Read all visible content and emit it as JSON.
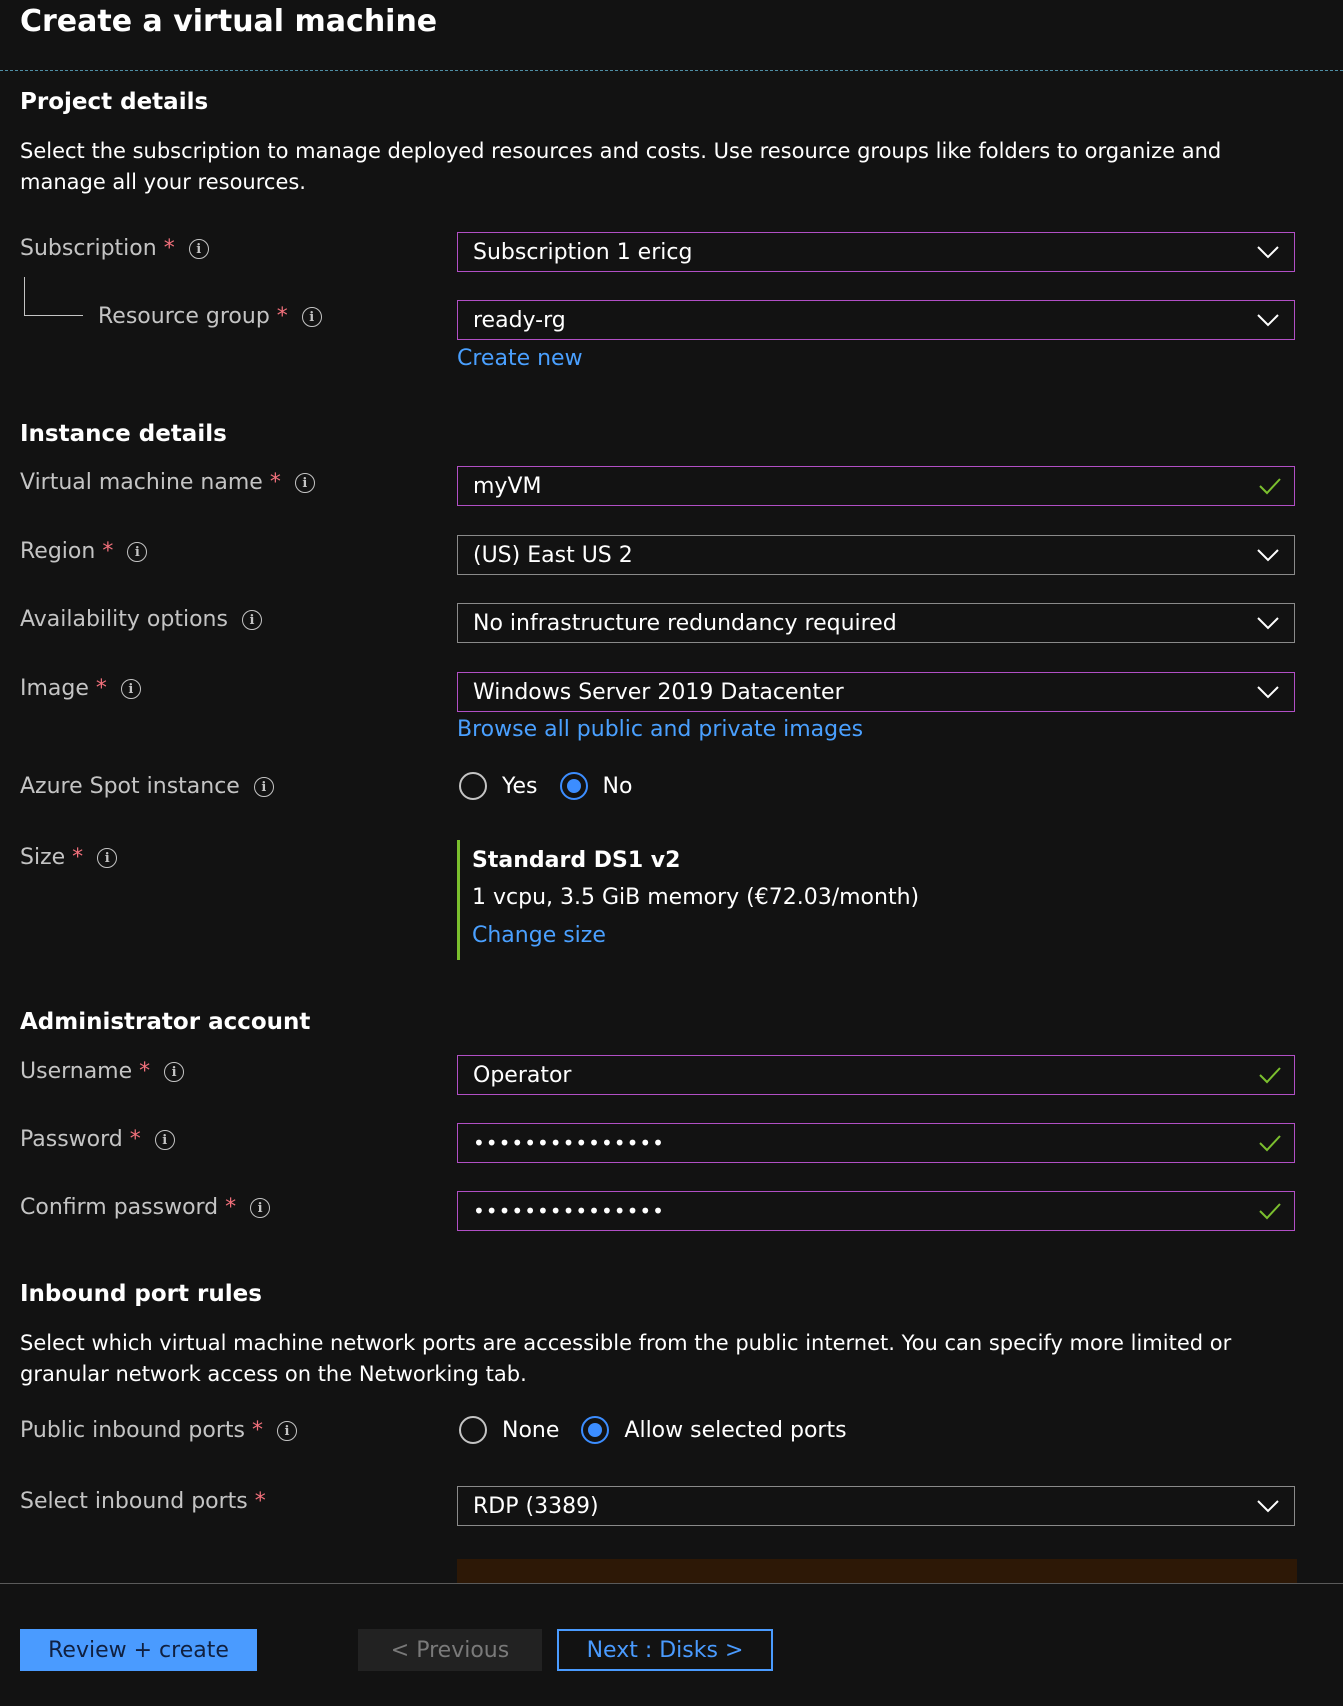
{
  "page": {
    "title": "Create a virtual machine"
  },
  "project": {
    "heading": "Project details",
    "description": "Select the subscription to manage deployed resources and costs. Use resource groups like folders to organize and manage all your resources.",
    "subscription": {
      "label": "Subscription",
      "value": "Subscription 1 ericg"
    },
    "resource_group": {
      "label": "Resource group",
      "value": "ready-rg",
      "link": "Create new"
    }
  },
  "instance": {
    "heading": "Instance details",
    "vm_name": {
      "label": "Virtual machine name",
      "value": "myVM"
    },
    "region": {
      "label": "Region",
      "value": "(US) East US 2"
    },
    "availability": {
      "label": "Availability options",
      "value": "No infrastructure redundancy required"
    },
    "image": {
      "label": "Image",
      "value": "Windows Server 2019 Datacenter",
      "link": "Browse all public and private images"
    },
    "spot": {
      "label": "Azure Spot instance",
      "options": [
        "Yes",
        "No"
      ],
      "selected": "No"
    },
    "size": {
      "label": "Size",
      "name": "Standard DS1 v2",
      "details": "1 vcpu, 3.5 GiB memory (€72.03/month)",
      "link": "Change size"
    }
  },
  "admin": {
    "heading": "Administrator account",
    "username": {
      "label": "Username",
      "value": "Operator"
    },
    "password": {
      "label": "Password",
      "value": "•••••••••••••••"
    },
    "confirm_password": {
      "label": "Confirm password",
      "value": "•••••••••••••••"
    }
  },
  "inbound": {
    "heading": "Inbound port rules",
    "description": "Select which virtual machine network ports are accessible from the public internet. You can specify more limited or granular network access on the Networking tab.",
    "public_ports": {
      "label": "Public inbound ports",
      "options": [
        "None",
        "Allow selected ports"
      ],
      "selected": "Allow selected ports"
    },
    "select_ports": {
      "label": "Select inbound ports",
      "value": "RDP (3389)"
    }
  },
  "footer": {
    "review_create": "Review + create",
    "previous": "< Previous",
    "next": "Next : Disks >"
  },
  "colors": {
    "accent": "#4a9bff",
    "field_border": "#b14fc5",
    "required": "#f1707b",
    "valid_check": "#7bbf2e"
  }
}
